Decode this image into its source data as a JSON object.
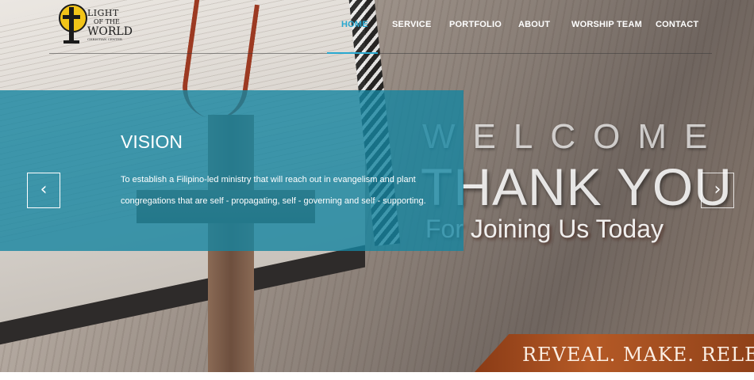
{
  "brand": {
    "logo_line1": "LIGHT",
    "logo_line2": "OF THE",
    "logo_line3": "WORLD",
    "logo_subline": "CHRISTIAN CENTER"
  },
  "nav": {
    "items": [
      "HOME",
      "SERVICE",
      "PORTFOLIO",
      "ABOUT",
      "WORSHIP TEAM",
      "CONTACT"
    ],
    "active_index": 0
  },
  "slide": {
    "title": "VISION",
    "text": "To establish a Filipino-led ministry that will reach out in evangelism and plant congregations that are self - propagating, self - governing and self - supporting.",
    "prev_arrow": "‹",
    "next_arrow": "›"
  },
  "hero_image_text": {
    "welcome": "WELCOME",
    "thank_you": "THANK YOU",
    "joining": "For Joining Us Today",
    "banner": "REVEAL. MAKE. RELEAS"
  },
  "slider": {
    "dot_count": 3,
    "active_dot": 0
  },
  "colors": {
    "accent": "#29a8cf",
    "panel": "#1584a0",
    "banner": "#a0481c"
  }
}
